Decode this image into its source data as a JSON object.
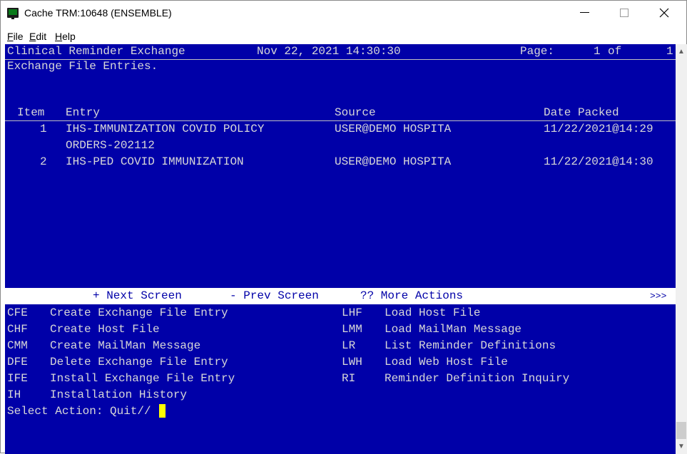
{
  "window": {
    "title": "Cache TRM:10648 (ENSEMBLE)"
  },
  "menu": {
    "items": [
      {
        "label": "File",
        "accel": "F",
        "rest": "ile"
      },
      {
        "label": "Edit",
        "accel": "E",
        "rest": "dit"
      },
      {
        "label": "Help",
        "accel": "H",
        "rest": "elp"
      }
    ]
  },
  "header": {
    "app_name": "Clinical Reminder Exchange",
    "datetime": "Nov 22, 2021 14:30:30",
    "page_label": "Page:",
    "page_current": "1",
    "page_of": "of",
    "page_total": "1"
  },
  "subtitle": "Exchange File Entries.",
  "table": {
    "columns": {
      "item": "Item",
      "entry": "Entry",
      "source": "Source",
      "date_packed": "Date Packed"
    },
    "rows": [
      {
        "item": "1",
        "entry": "IHS-IMMUNIZATION COVID POLICY",
        "entry_cont": "ORDERS-202112",
        "source": "USER@DEMO HOSPITA",
        "date": "11/22/2021@14:29"
      },
      {
        "item": "2",
        "entry": "IHS-PED COVID IMMUNIZATION",
        "entry_cont": "",
        "source": "USER@DEMO HOSPITA",
        "date": "11/22/2021@14:30"
      }
    ]
  },
  "nav": {
    "next": "+ Next Screen",
    "prev": "- Prev Screen",
    "more": "?? More Actions",
    "more_symbol": ">>>"
  },
  "actions": {
    "left": [
      {
        "code": "CFE",
        "label": "Create Exchange File Entry"
      },
      {
        "code": "CHF",
        "label": "Create Host File"
      },
      {
        "code": "CMM",
        "label": "Create MailMan Message"
      },
      {
        "code": "DFE",
        "label": "Delete Exchange File Entry"
      },
      {
        "code": "IFE",
        "label": "Install Exchange File Entry"
      },
      {
        "code": "IH",
        "label": "Installation History"
      }
    ],
    "right": [
      {
        "code": "LHF",
        "label": "Load Host File"
      },
      {
        "code": "LMM",
        "label": "Load MailMan Message"
      },
      {
        "code": "LR",
        "label": "List Reminder Definitions"
      },
      {
        "code": "LWH",
        "label": "Load Web Host File"
      },
      {
        "code": "RI",
        "label": "Reminder Definition Inquiry"
      }
    ]
  },
  "prompt": {
    "text": "Select Action: Quit//"
  },
  "colors": {
    "terminal_bg": "#0000a8",
    "terminal_fg": "#d8d8d8",
    "cursor": "#ffff00"
  }
}
